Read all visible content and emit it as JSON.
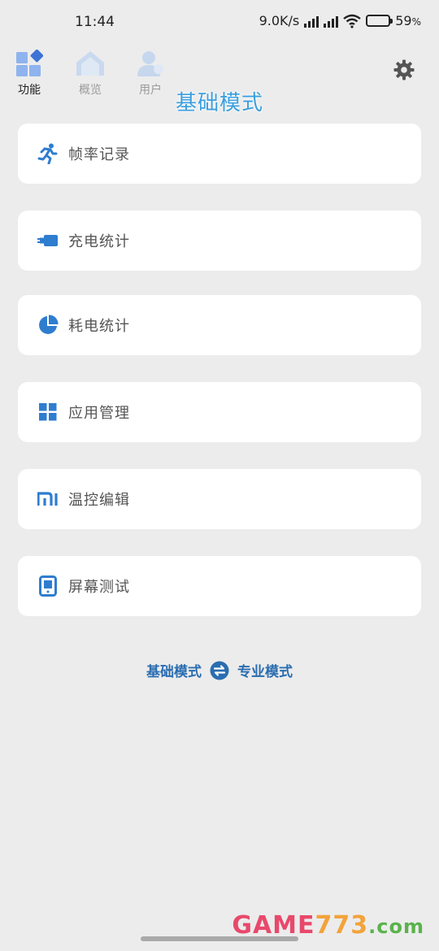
{
  "status_bar": {
    "time": "11:44",
    "net_speed": "9.0K/s",
    "battery_percent": "59",
    "battery_suffix": "%",
    "battery_level": 0.59
  },
  "nav": {
    "tabs": [
      {
        "label": "功能",
        "icon": "function-grid-icon",
        "active": true
      },
      {
        "label": "概览",
        "icon": "overview-home-icon",
        "active": false
      },
      {
        "label": "用户",
        "icon": "user-icon",
        "active": false
      }
    ],
    "settings_icon": "gear-icon"
  },
  "page_title": "基础模式",
  "cards": [
    {
      "label": "帧率记录",
      "icon": "running-person-icon"
    },
    {
      "label": "充电统计",
      "icon": "charging-plug-icon"
    },
    {
      "label": "耗电统计",
      "icon": "pie-chart-icon"
    },
    {
      "label": "应用管理",
      "icon": "app-grid-icon"
    },
    {
      "label": "温控编辑",
      "icon": "mi-logo-icon"
    },
    {
      "label": "屏幕测试",
      "icon": "phone-screen-icon"
    }
  ],
  "mode_switch": {
    "left": "基础模式",
    "right": "专业模式",
    "icon": "swap-icon"
  },
  "watermark": {
    "text_a": "GAME",
    "text_b": "773",
    "text_c": ".com"
  },
  "colors": {
    "accent": "#2a6db0",
    "title": "#3a9fde",
    "icon_blue": "#2f7dcf",
    "background": "#ececec"
  }
}
